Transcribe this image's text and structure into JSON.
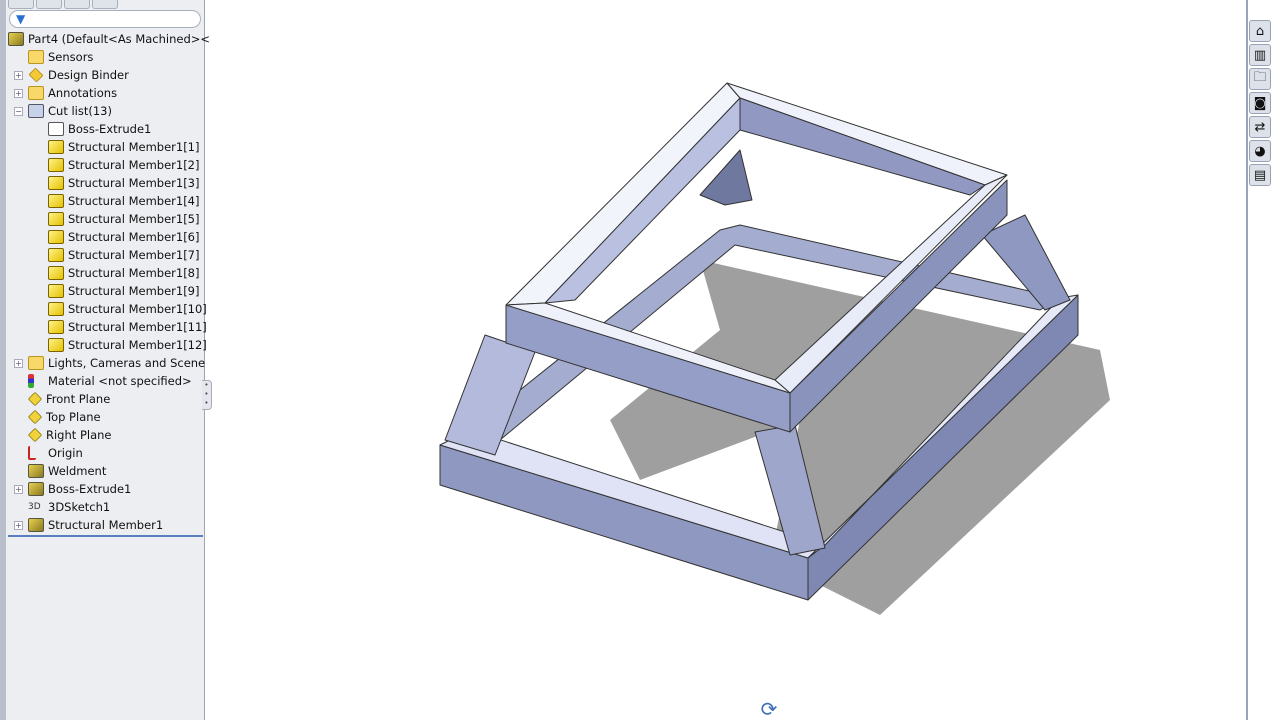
{
  "feature_tree": {
    "root": "Part4  (Default<As Machined><",
    "items": [
      {
        "label": "Sensors",
        "icon": "sensors-folder-icon",
        "expand": false,
        "indent": 1
      },
      {
        "label": "Design Binder",
        "icon": "design-binder-icon",
        "expand": true,
        "indent": 1
      },
      {
        "label": "Annotations",
        "icon": "annotations-folder-icon",
        "expand": true,
        "indent": 1
      },
      {
        "label": "Cut list(13)",
        "icon": "cut-list-icon",
        "expand": true,
        "expanded": true,
        "indent": 1
      },
      {
        "label": "Boss-Extrude1",
        "icon": "body-icon",
        "indent": 2
      },
      {
        "label": "Structural Member1[1]",
        "icon": "solid-body-icon",
        "indent": 2
      },
      {
        "label": "Structural Member1[2]",
        "icon": "solid-body-icon",
        "indent": 2
      },
      {
        "label": "Structural Member1[3]",
        "icon": "solid-body-icon",
        "indent": 2
      },
      {
        "label": "Structural Member1[4]",
        "icon": "solid-body-icon",
        "indent": 2
      },
      {
        "label": "Structural Member1[5]",
        "icon": "solid-body-icon",
        "indent": 2
      },
      {
        "label": "Structural Member1[6]",
        "icon": "solid-body-icon",
        "indent": 2
      },
      {
        "label": "Structural Member1[7]",
        "icon": "solid-body-icon",
        "indent": 2
      },
      {
        "label": "Structural Member1[8]",
        "icon": "solid-body-icon",
        "indent": 2
      },
      {
        "label": "Structural Member1[9]",
        "icon": "solid-body-icon",
        "indent": 2
      },
      {
        "label": "Structural Member1[10]",
        "icon": "solid-body-icon",
        "indent": 2
      },
      {
        "label": "Structural Member1[11]",
        "icon": "solid-body-icon",
        "indent": 2
      },
      {
        "label": "Structural Member1[12]",
        "icon": "solid-body-icon",
        "indent": 2
      },
      {
        "label": "Lights, Cameras and Scene",
        "icon": "lights-folder-icon",
        "expand": true,
        "indent": 1
      },
      {
        "label": "Material <not specified>",
        "icon": "material-icon",
        "indent": 1
      },
      {
        "label": "Front Plane",
        "icon": "plane-icon",
        "indent": 1
      },
      {
        "label": "Top Plane",
        "icon": "plane-icon",
        "indent": 1
      },
      {
        "label": "Right Plane",
        "icon": "plane-icon",
        "indent": 1
      },
      {
        "label": "Origin",
        "icon": "origin-icon",
        "indent": 1
      },
      {
        "label": "Weldment",
        "icon": "weldment-icon",
        "indent": 1
      },
      {
        "label": "Boss-Extrude1",
        "icon": "extrude-icon",
        "expand": true,
        "indent": 1
      },
      {
        "label": "3DSketch1",
        "icon": "sketch3d-icon",
        "indent": 1
      },
      {
        "label": "Structural Member1",
        "icon": "structural-member-icon",
        "expand": true,
        "indent": 1
      }
    ]
  },
  "task_pane": [
    "home-icon",
    "resources-icon",
    "folder-icon",
    "view-palette-icon",
    "file-explorer-icon",
    "appearances-icon",
    "custom-properties-icon"
  ],
  "colors": {
    "accent": "#5a7fbf",
    "model": "#9aa3c8",
    "shadow": "#8e8e8e"
  }
}
